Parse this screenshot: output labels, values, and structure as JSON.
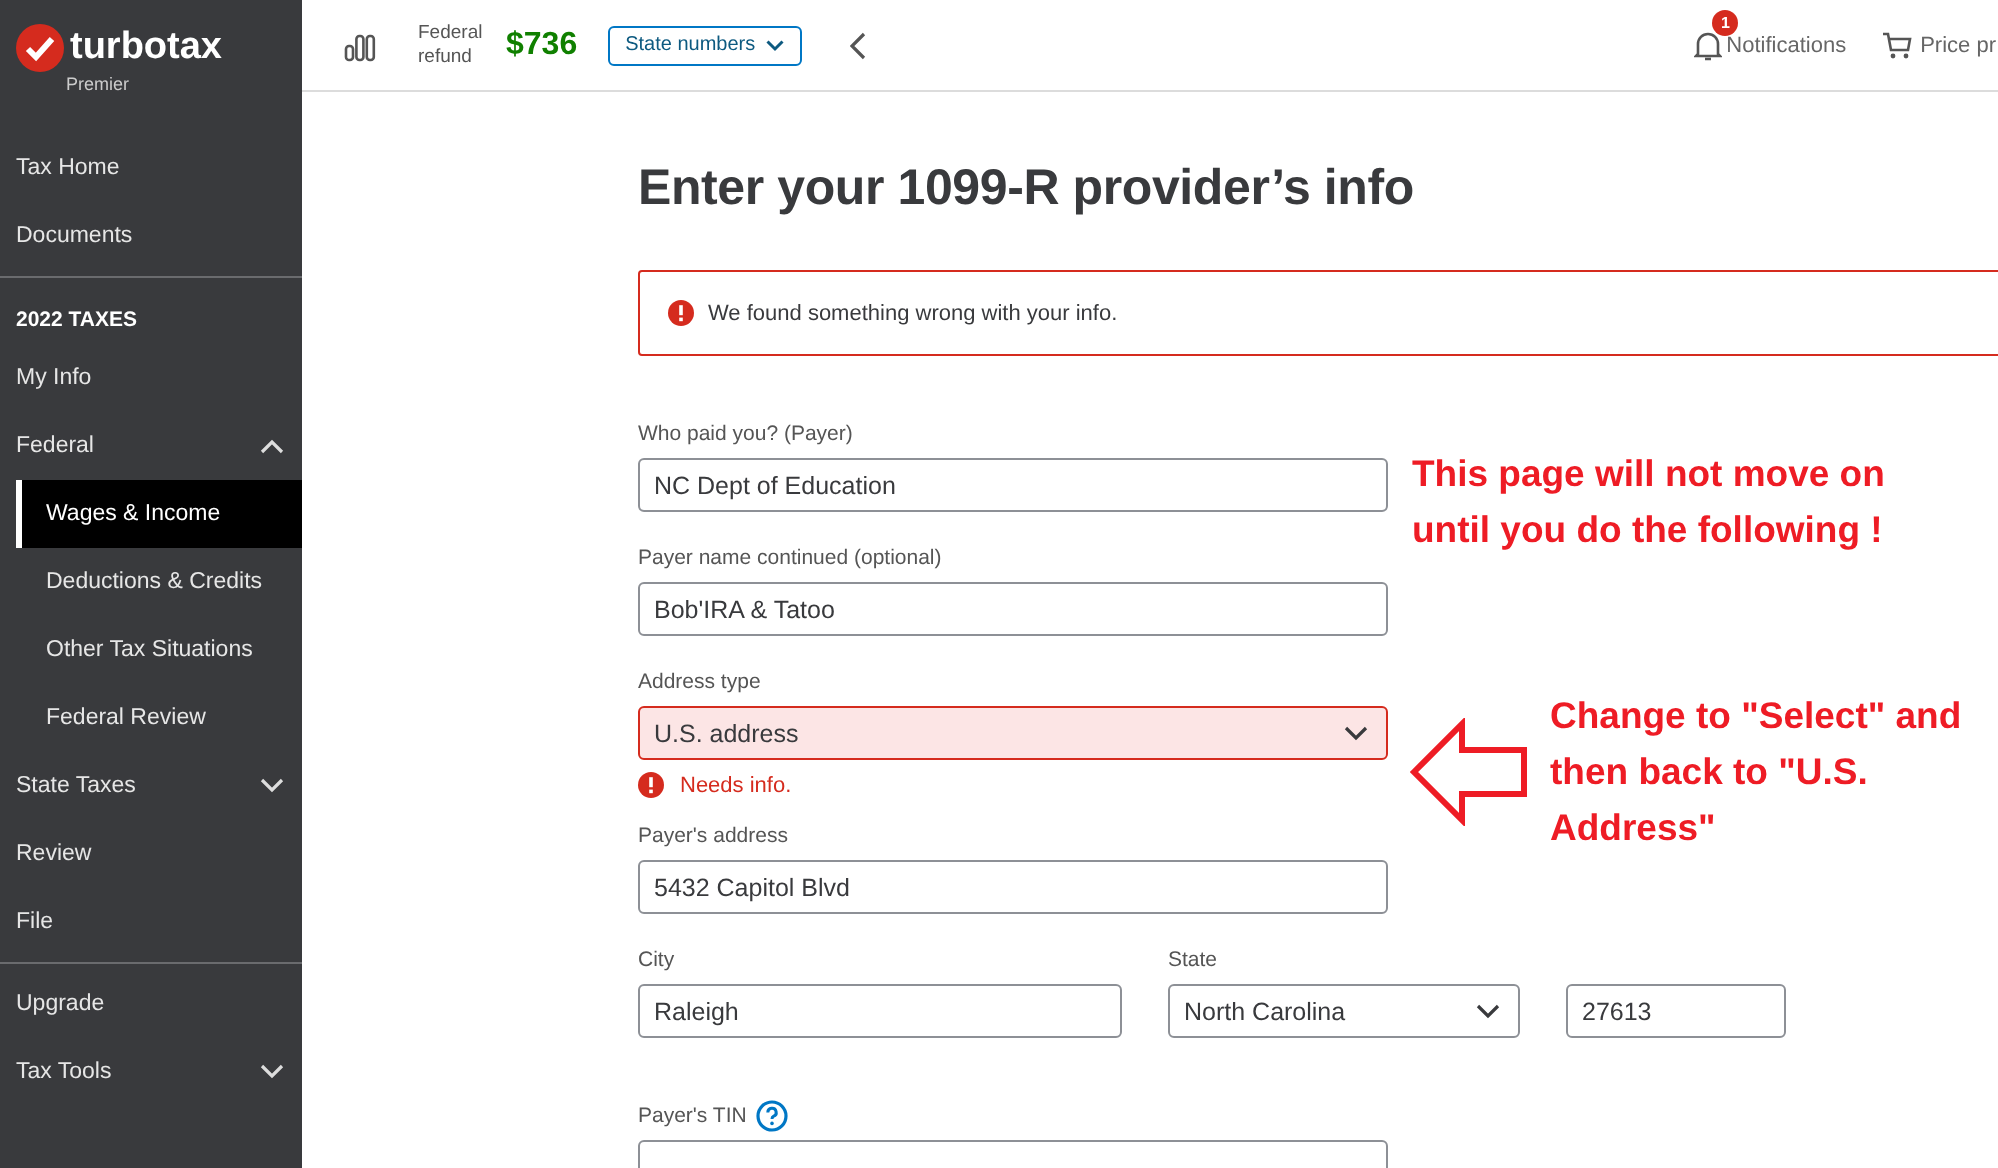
{
  "sidebar": {
    "logo": "turbotax",
    "edition": "Premier",
    "sections": [
      {
        "items": [
          {
            "label": "Tax Home",
            "selected": false
          },
          {
            "label": "Documents",
            "selected": false
          }
        ]
      },
      {
        "heading": "2022 TAXES",
        "items": [
          {
            "label": "My Info",
            "selected": false
          },
          {
            "label": "Federal",
            "selected": false,
            "expanded": true,
            "children": [
              {
                "label": "Wages & Income",
                "selected": true
              },
              {
                "label": "Deductions & Credits",
                "selected": false
              },
              {
                "label": "Other Tax Situations",
                "selected": false
              },
              {
                "label": "Federal Review",
                "selected": false
              }
            ]
          },
          {
            "label": "State Taxes",
            "selected": false,
            "expanded": false
          },
          {
            "label": "Review",
            "selected": false
          },
          {
            "label": "File",
            "selected": false
          }
        ]
      },
      {
        "items": [
          {
            "label": "Upgrade",
            "selected": false
          },
          {
            "label": "Tax Tools",
            "selected": false,
            "expanded": false
          }
        ]
      }
    ]
  },
  "topbar": {
    "refund_label": "Federal refund",
    "refund_amount": "$736",
    "state_button": "State numbers",
    "notifications": {
      "label": "Notifications",
      "count": "1"
    },
    "price_link": "Price pr"
  },
  "page": {
    "title": "Enter your 1099-R provider’s info",
    "error_banner": "We found something wrong with your info.",
    "fields": [
      {
        "kind": "text",
        "label": "Who paid you? (Payer)",
        "value": "NC Dept of Education"
      },
      {
        "kind": "text",
        "label": "Payer name continued (optional)",
        "value": "Bob'IRA & Tatoo"
      },
      {
        "kind": "select",
        "label": "Address type",
        "value": "U.S. address",
        "invalid": true,
        "error": "Needs info."
      },
      {
        "kind": "text",
        "label": "Payer's address",
        "value": "5432 Capitol Blvd"
      },
      {
        "kind": "row",
        "fields": [
          {
            "kind": "text",
            "label": "City",
            "value": "Raleigh"
          },
          {
            "kind": "select",
            "label": "State",
            "value": "North Carolina"
          },
          {
            "kind": "text",
            "value": "27613"
          }
        ]
      },
      {
        "kind": "text",
        "label": "Payer's TIN",
        "help": true
      }
    ]
  },
  "annotations": [
    {
      "lines": [
        "This page will not move on",
        "until you do the following !"
      ],
      "arrow": false
    },
    {
      "lines": [
        "Change to \"Select\" and",
        "then back to \"U.S.",
        "Address\""
      ],
      "arrow": true
    }
  ]
}
